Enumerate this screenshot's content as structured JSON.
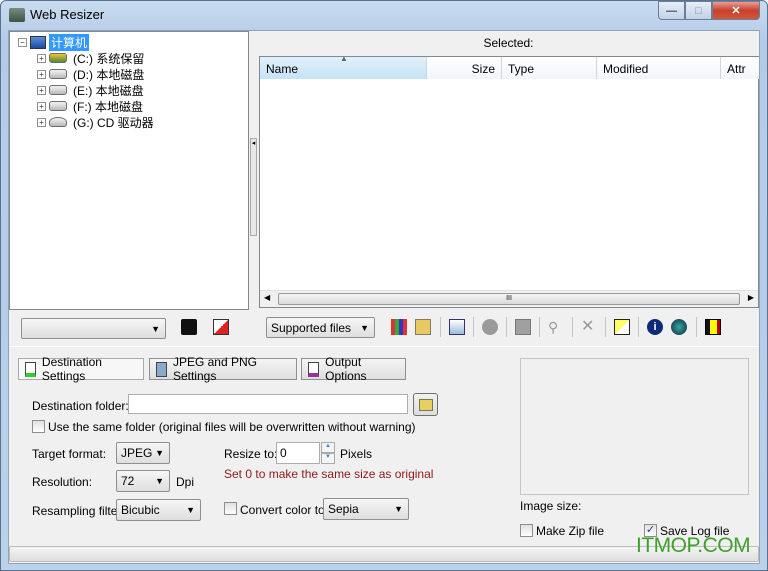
{
  "window": {
    "title": "Web Resizer",
    "minimize": "—",
    "maximize": "□",
    "close": "✕"
  },
  "tree": {
    "root": "计算机",
    "items": [
      {
        "label": "(C:) 系统保留",
        "icon": "system-drive-icon"
      },
      {
        "label": "(D:) 本地磁盘",
        "icon": "drive-icon"
      },
      {
        "label": "(E:) 本地磁盘",
        "icon": "drive-icon"
      },
      {
        "label": "(F:) 本地磁盘",
        "icon": "drive-icon"
      },
      {
        "label": "(G:) CD 驱动器",
        "icon": "cd-drive-icon"
      }
    ]
  },
  "filelist": {
    "selected_label": "Selected:",
    "columns": [
      "Name",
      "Size",
      "Type",
      "Modified",
      "Attr"
    ],
    "scroll_grip": "III"
  },
  "toolbar": {
    "path_combo": "",
    "filter_combo": "Supported files"
  },
  "tabs": [
    "Destination Settings",
    "JPEG and PNG Settings",
    "Output Options"
  ],
  "settings": {
    "destination_folder_label": "Destination folder:",
    "destination_folder_value": "",
    "same_folder_label": "Use the same folder (original files will be overwritten without warning)",
    "same_folder_checked": false,
    "target_format_label": "Target format:",
    "target_format": "JPEG",
    "resolution_label": "Resolution:",
    "resolution": "72",
    "dpi": "Dpi",
    "resampling_label": "Resampling filter:",
    "resampling": "Bicubic",
    "resize_label": "Resize to:",
    "resize_value": "0",
    "pixels": "Pixels",
    "hint": "Set 0 to make the same size as original",
    "hint_color": "#8b1a1a",
    "convert_label": "Convert color to:",
    "convert_checked": false,
    "convert_value": "Sepia"
  },
  "preview": {
    "image_size_label": "Image size:",
    "zip_label": "Make Zip file",
    "zip_checked": false,
    "log_label": "Save Log file",
    "log_checked": true
  },
  "watermark": "ITMOP.COM"
}
